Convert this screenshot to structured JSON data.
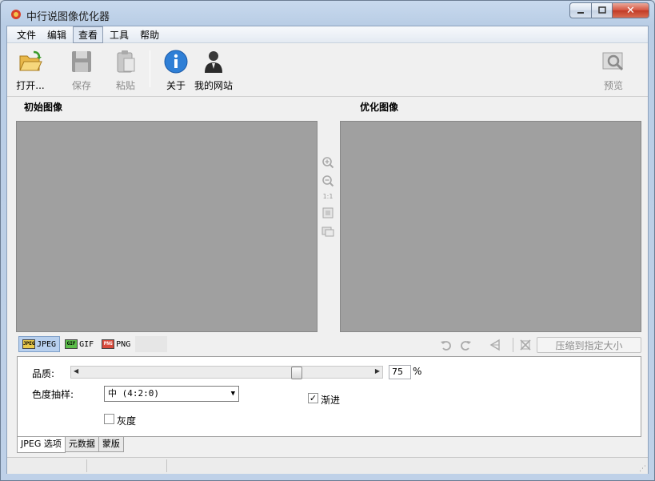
{
  "window": {
    "title": "中行说图像优化器"
  },
  "menu": [
    "文件",
    "编辑",
    "查看",
    "工具",
    "帮助"
  ],
  "toolbar": {
    "open": "打开...",
    "save": "保存",
    "paste": "粘贴",
    "about": "关于",
    "website": "我的网站",
    "preview": "预览"
  },
  "panels": {
    "original": "初始图像",
    "optimized": "优化图像"
  },
  "zoom_ratio": "1:1",
  "formats": [
    {
      "label": "JPEG",
      "icon": "JPEG"
    },
    {
      "label": "GIF",
      "icon": "GIF"
    },
    {
      "label": "PNG",
      "icon": "PNG"
    }
  ],
  "compress_button": "压缩到指定大小",
  "options": {
    "quality_label": "品质:",
    "quality_value": "75",
    "quality_fraction": 0.75,
    "percent": "%",
    "chroma_label": "色度抽样:",
    "chroma_value": "中 (4:2:0)",
    "progressive_label": "渐进",
    "progressive_checked": true,
    "grayscale_label": "灰度",
    "grayscale_checked": false
  },
  "bottom_tabs": [
    "JPEG 选项",
    "元数据",
    "蒙版"
  ],
  "colors": {
    "pane_bg": "#a0a0a0",
    "title_bar": "#bfd1e8"
  }
}
